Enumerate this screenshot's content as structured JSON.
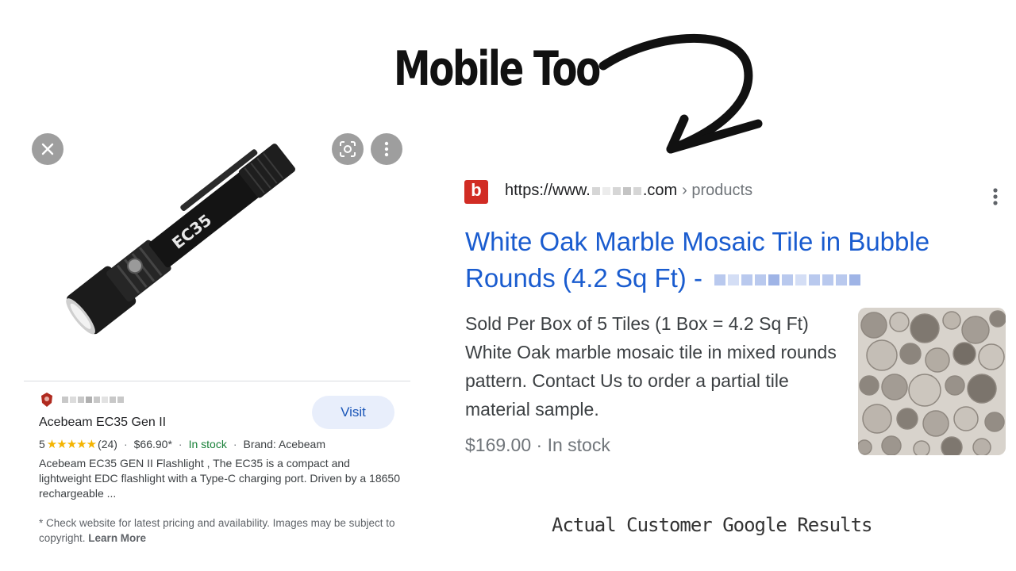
{
  "headline": "Mobile Too",
  "caption": "Actual Customer Google Results",
  "left_result": {
    "buttons": {
      "close_icon": "close-icon",
      "lens_icon": "lens-icon",
      "more_icon": "more-vert-icon"
    },
    "title": "Acebeam EC35 Gen II",
    "visit_label": "Visit",
    "rating": "5",
    "stars": "★★★★★",
    "review_count": "(24)",
    "price": "$66.90*",
    "stock": "In stock",
    "brand": "Brand: Acebeam",
    "description": "Acebeam EC35 GEN II Flashlight , The EC35 is a compact and lightweight EDC flashlight with a Type-C charging port. Driven by a 18650 rechargeable ...",
    "footer_text": "* Check website for latest pricing and availability. Images may be subject to copyright.",
    "footer_link": "Learn More",
    "product_label": "EC35"
  },
  "right_result": {
    "favicon_letter": "b",
    "url_prefix": "https://www.",
    "url_suffix": ".com",
    "breadcrumb": "› products",
    "title": "White Oak Marble Mosaic Tile in Bubble Rounds (4.2 Sq Ft) -",
    "description": "Sold Per Box of 5 Tiles (1 Box = 4.2 Sq Ft) White Oak marble mosaic tile in mixed rounds pattern. Contact Us to order a partial tile material sample.",
    "price_stock": "$169.00 · In stock"
  },
  "colors": {
    "link": "#1a5ccf",
    "stock_green": "#188038",
    "star": "#f4b400",
    "favicon": "#d12c24",
    "visit_bg": "#e8eefb"
  }
}
